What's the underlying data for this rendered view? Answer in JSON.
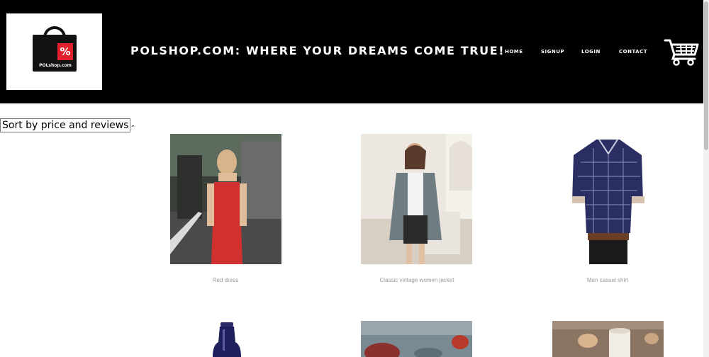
{
  "header": {
    "logo_text": "POLshop.com",
    "logo_symbol": "%",
    "title": "POLSHOP.COM: WHERE YOUR DREAMS COME TRUE!",
    "nav": [
      {
        "label": "HOME"
      },
      {
        "label": "SIGNUP"
      },
      {
        "label": "LOGIN"
      },
      {
        "label": "CONTACT"
      }
    ],
    "cart_icon": "shopping-cart-icon"
  },
  "sort": {
    "selected": "Sort by price and reviews"
  },
  "products": [
    {
      "name": "Red dress"
    },
    {
      "name": "Classic vintage women jacket"
    },
    {
      "name": "Men casual shirt"
    },
    {
      "name": ""
    },
    {
      "name": ""
    },
    {
      "name": ""
    }
  ],
  "colors": {
    "header_bg": "#000000",
    "logo_tag": "#e0202c",
    "caption": "#999999"
  }
}
